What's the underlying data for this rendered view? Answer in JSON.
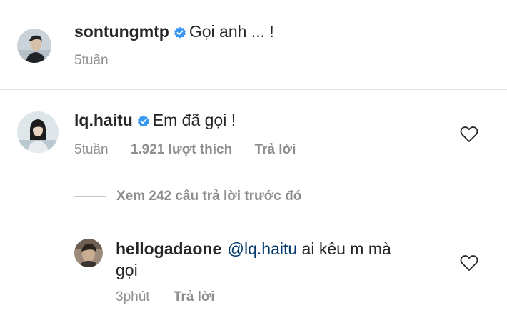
{
  "caption": {
    "username": "sontungmtp",
    "text": "Gọi anh ... !",
    "time": "5tuần"
  },
  "comment": {
    "username": "lq.haitu",
    "text": "Em đã gọi !",
    "time": "5tuần",
    "likes": "1.921 lượt thích",
    "reply_label": "Trả lời"
  },
  "view_replies": {
    "label": "Xem 242 câu trả lời trước đó"
  },
  "reply": {
    "username": "hellogadaone",
    "mention": "@lq.haitu",
    "text_line1": "ai kêu m mà",
    "text_line2": "gọi",
    "time": "3phút",
    "reply_label": "Trả lời"
  },
  "icons": {
    "verified": "verified-badge-icon",
    "like": "heart-outline-icon"
  },
  "colors": {
    "verified_blue": "#3897f0",
    "muted_text": "#8e8e8e",
    "mention_link": "#00376b"
  }
}
